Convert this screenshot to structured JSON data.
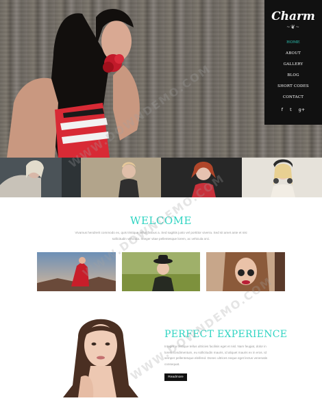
{
  "nav": {
    "logo": "Charm",
    "logo_flourish": "~❦~",
    "items": [
      {
        "label": "HOME",
        "active": true
      },
      {
        "label": "ABOUT",
        "active": false
      },
      {
        "label": "GALLERY",
        "active": false
      },
      {
        "label": "BLOG",
        "active": false
      },
      {
        "label": "SHORT CODES",
        "active": false
      },
      {
        "label": "CONTACT",
        "active": false
      }
    ],
    "social": [
      "f",
      "t",
      "g+"
    ]
  },
  "colors": {
    "accent": "#2fd4c2",
    "nav_bg": "#111111",
    "text_muted": "#9a9a9a"
  },
  "welcome": {
    "title": "WELCOME",
    "text": "Vivamus hendrerit commodo ex, quis tristique tellus finibus a. Sed sagittis justo vel porttitor viverra. Sed sit amet ante et nisi sollicitudin vehicula. Integer vitae pellentesque lorem, ac vehicula orci."
  },
  "experience": {
    "title": "PERFECT EXPERIENCE",
    "text": "Integer a tristique tellus ultricies facilisis eget et nisl. Nam feugiat, dolor in lorem condimentum, eu sollicitudin mauris, id aliquet mauris ex in eros. Id semper pellentesque eleifend. Donec ultrices neque eget lectus venenatis consequat.",
    "button": "Readmore"
  },
  "watermark": "WWW.DOWNDEMO.COM"
}
